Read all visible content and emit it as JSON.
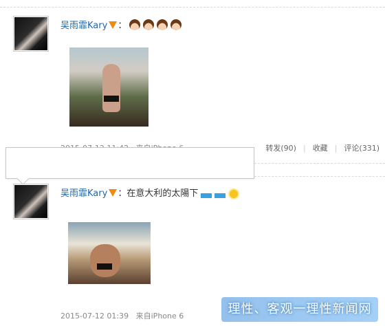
{
  "posts": [
    {
      "author": "吴雨霏Kary",
      "text_prefix": "：",
      "text": "",
      "time": "2015-07-12 11:42",
      "source": "来自iPhone 6",
      "repost": "转发(90)",
      "favorite": "收藏",
      "comment": "评论(331)"
    },
    {
      "author": "吴雨霏Kary",
      "text_prefix": "：",
      "text": "在意大利的太陽下",
      "time": "2015-07-12 01:39",
      "source": "来自iPhone 6"
    }
  ],
  "watermark": "理性、客观一理性新闻网",
  "colors": {
    "name": "#1f66aa",
    "vip_badge": "#f08a10",
    "meta": "#888888"
  },
  "icons": [
    "vip-badge",
    "emoji-girl",
    "emoji-wave",
    "emoji-sun"
  ]
}
